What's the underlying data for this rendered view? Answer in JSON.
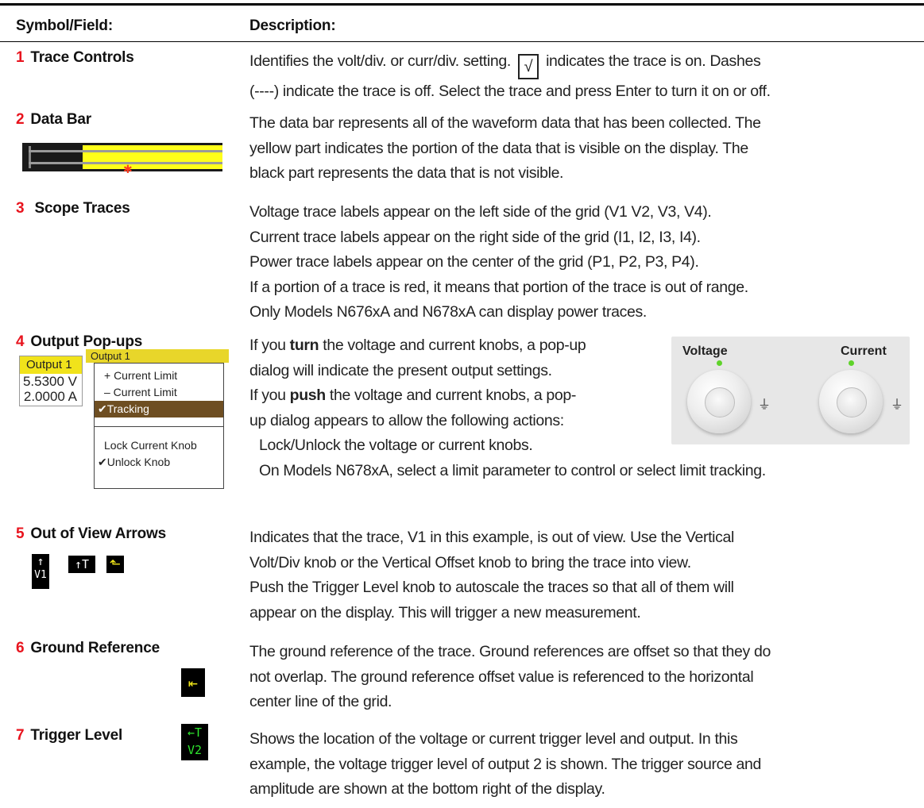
{
  "header": {
    "col1": "Symbol/Field:",
    "col2": "Description:"
  },
  "rows": [
    {
      "num": "1",
      "label": "Trace Controls",
      "d1a": "Identifies the volt/div. or curr/div. setting.",
      "check": "√",
      "d1b": "indicates the trace is on. Dashes",
      "d2": "(----) indicate the trace is off. Select the trace and press Enter to turn it on or off."
    },
    {
      "num": "2",
      "label": "Data Bar",
      "d1": "The data bar represents all of the waveform data that has been collected. The",
      "d2": "yellow part indicates the portion of the data that is visible on the display. The",
      "d3": "black part represents the data that is not visible."
    },
    {
      "num": "3",
      "label": "Scope Traces",
      "d1": "Voltage trace labels appear on the left side of the grid (V1  V2, V3, V4).",
      "d2": "Current trace labels appear on the right side of the grid (I1, I2, I3, I4).",
      "d3": "Power trace labels appear on the center of the grid (P1, P2, P3, P4).",
      "d4": "If a portion of a trace is red, it means that portion of the trace is out of range.",
      "d5": "Only Models N676xA and N678xA can display power traces."
    },
    {
      "num": "4",
      "label": "Output Pop-ups",
      "d1a": "If you ",
      "d1b": "turn",
      "d1c": " the voltage and current knobs, a pop-up",
      "d2": "dialog will indicate the present output settings.",
      "d3a": "If you ",
      "d3b": "push",
      "d3c": " the voltage and current knobs, a pop-",
      "d4": "up dialog appears to allow the following actions:",
      "d5": "Lock/Unlock the voltage or current knobs.",
      "d6": "On Models N678xA, select a limit parameter to control or select limit tracking.",
      "popup1": {
        "title": "Output 1",
        "v": "5.5300 V",
        "a": "2.0000 A"
      },
      "popup2": {
        "title": "Output 1",
        "items": [
          "+ Current Limit",
          "– Current Limit",
          "✔Tracking",
          "Lock Current Knob",
          "✔Unlock Knob"
        ]
      },
      "knobs": {
        "voltage": "Voltage",
        "current": "Current"
      }
    },
    {
      "num": "5",
      "label": "Out of View Arrows",
      "d1": "Indicates that the trace, V1 in this example, is out of view. Use the Vertical",
      "d2": "Volt/Div knob or the Vertical Offset knob to bring the trace into view.",
      "d3": "Push the Trigger Level knob to autoscale the traces so that all of them will",
      "d4": "appear on the display. This will trigger a new measurement.",
      "icon_a": "↑",
      "icon_a2": "V1",
      "icon_b": "↑T"
    },
    {
      "num": "6",
      "label": "Ground Reference",
      "d1": "The ground reference of the trace. Ground references are offset so that they do",
      "d2": "not overlap. The ground reference offset value is referenced to the horizontal",
      "d3": "center line of the grid."
    },
    {
      "num": "7",
      "label": "Trigger Level",
      "d1": "Shows the location of the voltage or current trigger level and output. In this",
      "d2": "example, the voltage trigger level of output 2 is shown. The trigger source and",
      "d3": "amplitude are shown at the bottom right of the display.",
      "icon_t1": "←T",
      "icon_t2": "V2"
    }
  ],
  "colors": {
    "number": "#e8141e",
    "databar_yellow": "#ffff1a",
    "icon_green": "#2ee62e",
    "icon_yellow": "#f3e81a"
  }
}
